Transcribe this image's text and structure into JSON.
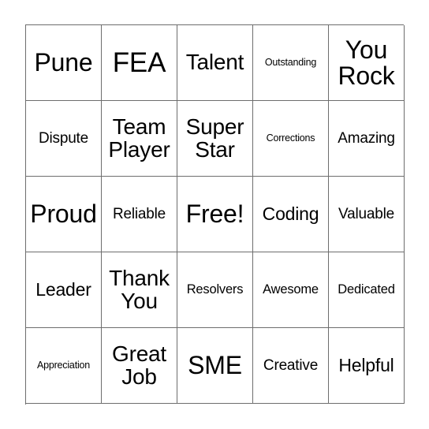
{
  "card": {
    "kind": "bingo-card",
    "rows": 5,
    "columns": 5,
    "border_color": "#6e6e6e",
    "text_color": "#000000",
    "background_color": "#ffffff",
    "free_space": "Free!",
    "cells": [
      {
        "text": "Pune",
        "size": "fs-2xl",
        "lines": 1
      },
      {
        "text": "FEA",
        "size": "fs-3xl",
        "lines": 1
      },
      {
        "text": "Talent",
        "size": "fs-xl",
        "lines": 1
      },
      {
        "text": "Outstanding",
        "size": "fs-xs",
        "lines": 1
      },
      {
        "text": "You\nRock",
        "size": "fs-2xl",
        "lines": 2
      },
      {
        "text": "Dispute",
        "size": "fs-md",
        "lines": 1
      },
      {
        "text": "Team\nPlayer",
        "size": "fs-xl",
        "lines": 2
      },
      {
        "text": "Super\nStar",
        "size": "fs-xl",
        "lines": 2
      },
      {
        "text": "Corrections",
        "size": "fs-xs",
        "lines": 1
      },
      {
        "text": "Amazing",
        "size": "fs-md",
        "lines": 1
      },
      {
        "text": "Proud",
        "size": "fs-2xl",
        "lines": 1
      },
      {
        "text": "Reliable",
        "size": "fs-md",
        "lines": 1
      },
      {
        "text": "Free!",
        "size": "fs-2xl",
        "lines": 1
      },
      {
        "text": "Coding",
        "size": "fs-lg",
        "lines": 1
      },
      {
        "text": "Valuable",
        "size": "fs-md",
        "lines": 1
      },
      {
        "text": "Leader",
        "size": "fs-lg",
        "lines": 1
      },
      {
        "text": "Thank\nYou",
        "size": "fs-xl",
        "lines": 2
      },
      {
        "text": "Resolvers",
        "size": "fs-sm",
        "lines": 1
      },
      {
        "text": "Awesome",
        "size": "fs-sm",
        "lines": 1
      },
      {
        "text": "Dedicated",
        "size": "fs-sm",
        "lines": 1
      },
      {
        "text": "Appreciation",
        "size": "fs-xs",
        "lines": 1
      },
      {
        "text": "Great\nJob",
        "size": "fs-xl",
        "lines": 2
      },
      {
        "text": "SME",
        "size": "fs-2xl",
        "lines": 1
      },
      {
        "text": "Creative",
        "size": "fs-md",
        "lines": 1
      },
      {
        "text": "Helpful",
        "size": "fs-lg",
        "lines": 1
      }
    ]
  }
}
